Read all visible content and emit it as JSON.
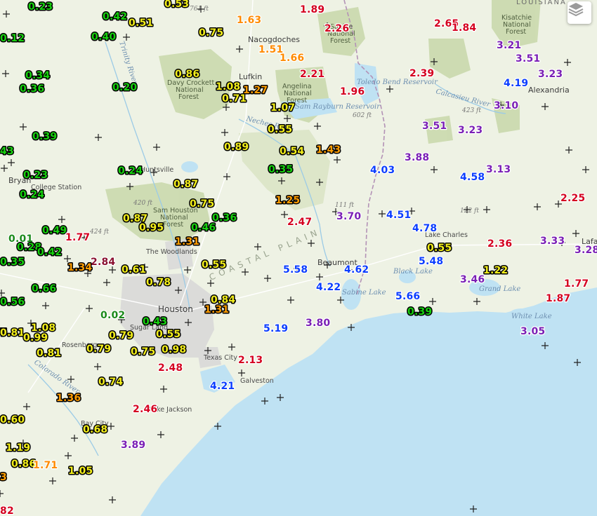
{
  "map": {
    "layers_button_icon": "layers-icon",
    "colors": {
      "green": "#16d10e",
      "yellow": "#f2ee1a",
      "orange": "#ff9d00",
      "light_orange": "#ff8a00",
      "red": "#d4001f",
      "purple": "#7a1fb5",
      "blue": "#0b3dff",
      "dark_green": "#1b8a1b",
      "dark_red": "#8a1030",
      "land": "#eef2e4",
      "forest": "#cad9ad",
      "water": "#bfe2f3",
      "urban": "#d6d6d6"
    },
    "places": {
      "nacogdoches": "Nacogdoches",
      "lufkin": "Lufkin",
      "huntsville": "Huntsville",
      "bryan": "Bryan",
      "college_station": "College Station",
      "the_woodlands": "The Woodlands",
      "houston": "Houston",
      "sugar_land": "Sugar Land",
      "rosenberg": "Rosenberg",
      "texas_city": "Texas City",
      "galveston": "Galveston",
      "lake_jackson": "Lake Jackson",
      "bay_city": "Bay City",
      "beaumont": "Beaumont",
      "lake_charles": "Lake Charles",
      "alexandria": "Alexandria",
      "lafayette": "Lafa",
      "louisiana": "LOUISIANA"
    },
    "forests": {
      "davy_crockett": [
        "Davy Crockett",
        "National",
        "Forest"
      ],
      "angelina": [
        "Angelina",
        "National",
        "Forest"
      ],
      "sabine": [
        "Sabine",
        "National",
        "Forest"
      ],
      "sam_houston": [
        "Sam Houston",
        "National",
        "Forest"
      ],
      "kisatchie": [
        "Kisatchie",
        "National",
        "Forest"
      ]
    },
    "waters": {
      "rayburn": "Sam Rayburn Reservoir",
      "toledo": "Toledo Bend Reservoir",
      "calcasieu": "Calcasieu River",
      "neches": "Neches River",
      "trinity": "Trinity River",
      "colorado": "Colorado River",
      "black_lake": "Black Lake",
      "grand_lake": "Grand Lake",
      "white_lake": "White Lake",
      "sabine_lake": "Sabine Lake"
    },
    "elevations": {
      "e761": "761 ft",
      "e602": "602 ft",
      "e423": "423 ft",
      "e420": "420 ft",
      "e424": "424 ft",
      "e111": "111 ft",
      "e122": "122 ft"
    },
    "region_label": "COASTAL PLAIN",
    "rainfall_values": [
      {
        "v": "0.23",
        "c": "green"
      },
      {
        "v": "0.53",
        "c": "yellow"
      },
      {
        "v": "0.42",
        "c": "green"
      },
      {
        "v": "0.51",
        "c": "yellow"
      },
      {
        "v": "0.12",
        "c": "green"
      },
      {
        "v": "0.40",
        "c": "green"
      },
      {
        "v": "0.75",
        "c": "yellow"
      },
      {
        "v": "1.63",
        "c": "light_orange"
      },
      {
        "v": "1.89",
        "c": "red"
      },
      {
        "v": "2.26",
        "c": "red"
      },
      {
        "v": "2.65",
        "c": "red"
      },
      {
        "v": "1.84",
        "c": "red"
      },
      {
        "v": "3.21",
        "c": "purple"
      },
      {
        "v": "1.51",
        "c": "light_orange"
      },
      {
        "v": "1.66",
        "c": "light_orange"
      },
      {
        "v": "3.51",
        "c": "purple"
      },
      {
        "v": "0.34",
        "c": "green"
      },
      {
        "v": "0.86",
        "c": "yellow"
      },
      {
        "v": "2.21",
        "c": "red"
      },
      {
        "v": "2.39",
        "c": "red"
      },
      {
        "v": "3.23",
        "c": "purple"
      },
      {
        "v": "0.36",
        "c": "green"
      },
      {
        "v": "0.20",
        "c": "green"
      },
      {
        "v": "1.08",
        "c": "yellow"
      },
      {
        "v": "1.27",
        "c": "orange"
      },
      {
        "v": "1.96",
        "c": "red"
      },
      {
        "v": "4.19",
        "c": "blue"
      },
      {
        "v": "0.71",
        "c": "yellow"
      },
      {
        "v": "1.07",
        "c": "yellow"
      },
      {
        "v": "3.10",
        "c": "purple"
      },
      {
        "v": "0.55",
        "c": "yellow"
      },
      {
        "v": "3.51",
        "c": "purple"
      },
      {
        "v": "3.23",
        "c": "purple"
      },
      {
        "v": "0.39",
        "c": "green"
      },
      {
        "v": "0.89",
        "c": "yellow"
      },
      {
        "v": "0.54",
        "c": "yellow"
      },
      {
        "v": "1.43",
        "c": "orange"
      },
      {
        "v": "43",
        "c": "green"
      },
      {
        "v": "3.88",
        "c": "purple"
      },
      {
        "v": "0.24",
        "c": "green"
      },
      {
        "v": "0.35",
        "c": "green"
      },
      {
        "v": "4.03",
        "c": "blue"
      },
      {
        "v": "3.13",
        "c": "purple"
      },
      {
        "v": "0.23",
        "c": "green"
      },
      {
        "v": "4.58",
        "c": "blue"
      },
      {
        "v": "0.87",
        "c": "yellow"
      },
      {
        "v": "0.24",
        "c": "green"
      },
      {
        "v": "1.25",
        "c": "orange"
      },
      {
        "v": "2.25",
        "c": "red"
      },
      {
        "v": "0.75",
        "c": "yellow"
      },
      {
        "v": "4.51",
        "c": "blue"
      },
      {
        "v": "0.36",
        "c": "green"
      },
      {
        "v": "3.70",
        "c": "purple"
      },
      {
        "v": "0.87",
        "c": "yellow"
      },
      {
        "v": "0.49",
        "c": "green"
      },
      {
        "v": "2.47",
        "c": "red"
      },
      {
        "v": "4.78",
        "c": "blue"
      },
      {
        "v": "0.95",
        "c": "yellow"
      },
      {
        "v": "0.46",
        "c": "green"
      },
      {
        "v": "0.01",
        "c": "dark_green"
      },
      {
        "v": "1.77",
        "c": "red"
      },
      {
        "v": "1.31",
        "c": "orange"
      },
      {
        "v": "0.55",
        "c": "yellow"
      },
      {
        "v": "2.36",
        "c": "red"
      },
      {
        "v": "3.33",
        "c": "purple"
      },
      {
        "v": "0.28",
        "c": "green"
      },
      {
        "v": "0.42",
        "c": "green"
      },
      {
        "v": "3.28",
        "c": "purple"
      },
      {
        "v": "2.84",
        "c": "dark_red"
      },
      {
        "v": "0.35",
        "c": "green"
      },
      {
        "v": "0.55",
        "c": "yellow"
      },
      {
        "v": "5.48",
        "c": "blue"
      },
      {
        "v": "1.34",
        "c": "orange"
      },
      {
        "v": "0.61",
        "c": "yellow"
      },
      {
        "v": "5.58",
        "c": "blue"
      },
      {
        "v": "4.62",
        "c": "blue"
      },
      {
        "v": "1.22",
        "c": "yellow"
      },
      {
        "v": "0.78",
        "c": "yellow"
      },
      {
        "v": "3.46",
        "c": "purple"
      },
      {
        "v": "0.66",
        "c": "green"
      },
      {
        "v": "4.22",
        "c": "blue"
      },
      {
        "v": "1.77",
        "c": "red"
      },
      {
        "v": "0.84",
        "c": "yellow"
      },
      {
        "v": "5.66",
        "c": "blue"
      },
      {
        "v": "0.56",
        "c": "green"
      },
      {
        "v": "1.87",
        "c": "red"
      },
      {
        "v": "1.31",
        "c": "orange"
      },
      {
        "v": "0.39",
        "c": "green"
      },
      {
        "v": "0.02",
        "c": "dark_green"
      },
      {
        "v": "0.43",
        "c": "green"
      },
      {
        "v": "7",
        "c": "green"
      },
      {
        "v": "1.08",
        "c": "yellow"
      },
      {
        "v": "3.80",
        "c": "purple"
      },
      {
        "v": "0.81",
        "c": "yellow"
      },
      {
        "v": "0.99",
        "c": "yellow"
      },
      {
        "v": "0.79",
        "c": "yellow"
      },
      {
        "v": "0.55",
        "c": "yellow"
      },
      {
        "v": "5.19",
        "c": "blue"
      },
      {
        "v": "3.05",
        "c": "purple"
      },
      {
        "v": "0.81",
        "c": "yellow"
      },
      {
        "v": "0.79",
        "c": "yellow"
      },
      {
        "v": "0.75",
        "c": "yellow"
      },
      {
        "v": "0.98",
        "c": "yellow"
      },
      {
        "v": "2.13",
        "c": "red"
      },
      {
        "v": "2.48",
        "c": "red"
      },
      {
        "v": "0.74",
        "c": "yellow"
      },
      {
        "v": "4.21",
        "c": "blue"
      },
      {
        "v": "1.36",
        "c": "orange"
      },
      {
        "v": "2.46",
        "c": "red"
      },
      {
        "v": "0.60",
        "c": "yellow"
      },
      {
        "v": "0.68",
        "c": "yellow"
      },
      {
        "v": "3.89",
        "c": "purple"
      },
      {
        "v": "1.19",
        "c": "yellow"
      },
      {
        "v": "0.86",
        "c": "yellow"
      },
      {
        "v": "1.71",
        "c": "light_orange"
      },
      {
        "v": "3",
        "c": "orange"
      },
      {
        "v": "1.05",
        "c": "yellow"
      },
      {
        "v": "82",
        "c": "red"
      }
    ]
  }
}
